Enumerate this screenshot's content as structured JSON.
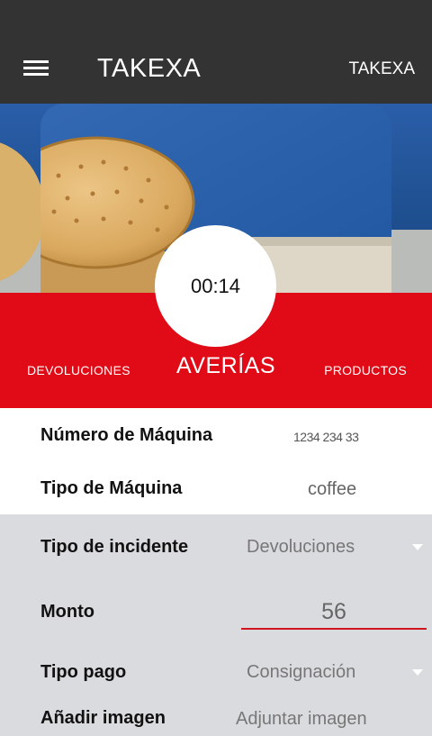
{
  "app_bar": {
    "title": "TAKEXA",
    "action_label": "TAKEXA"
  },
  "icons": {
    "menu": "hamburger-menu-icon",
    "dropdown": "caret-down-icon"
  },
  "timer": {
    "value": "00:14"
  },
  "tabs": {
    "left": "DEVOLUCIONES",
    "center": "AVERÍAS",
    "right": "PRODUCTOS"
  },
  "machine": {
    "number_label": "Número de Máquina",
    "number_value": "1234 234 33",
    "type_label": "Tipo de Máquina",
    "type_value": "coffee"
  },
  "form": {
    "incident_label": "Tipo de incidente",
    "incident_value": "Devoluciones",
    "amount_label": "Monto",
    "amount_value": "56",
    "payment_label": "Tipo pago",
    "payment_value": "Consignación",
    "image_label": "Añadir imagen",
    "image_action": "Adjuntar imagen"
  },
  "colors": {
    "app_bar": "#333333",
    "accent_red": "#e00b16",
    "underline_red": "#d0161f",
    "form_bg": "#d9dbde"
  }
}
